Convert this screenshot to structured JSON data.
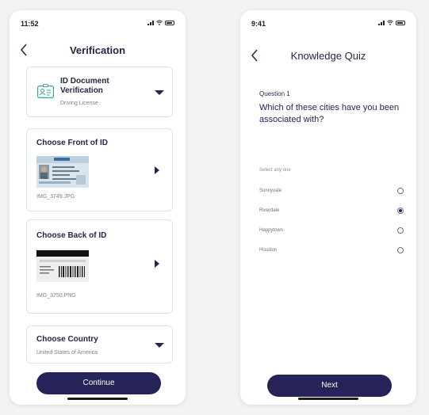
{
  "verification": {
    "status_time": "11:52",
    "title": "Verification",
    "id_document": {
      "title_line1": "ID Document",
      "title_line2": "Verification",
      "value": "Driving License"
    },
    "front": {
      "title": "Choose Front of ID",
      "filename": "IMG_3749.JPG"
    },
    "back": {
      "title": "Choose Back of ID",
      "filename": "IMG_3750.PNG"
    },
    "country": {
      "title": "Choose Country",
      "value": "United States of America"
    },
    "continue_label": "Continue"
  },
  "quiz": {
    "status_time": "9:41",
    "title": "Knowledge Quiz",
    "question_label": "Question 1",
    "question_text": "Which of these cities have you been associated with?",
    "select_hint": "Select any one",
    "options": [
      {
        "label": "Sunnyvale",
        "selected": false
      },
      {
        "label": "Riverdale",
        "selected": true
      },
      {
        "label": "Happytown",
        "selected": false
      },
      {
        "label": "Houston",
        "selected": false
      }
    ],
    "next_label": "Next"
  },
  "colors": {
    "primary": "#262358",
    "text": "#22264a",
    "border": "#e1e2e8",
    "accent": "#3aa39a"
  },
  "icons": [
    "chevron-left-icon",
    "id-card-icon",
    "caret-down-icon",
    "caret-right-icon",
    "radio-icon",
    "signal-icon",
    "wifi-icon",
    "battery-icon"
  ]
}
